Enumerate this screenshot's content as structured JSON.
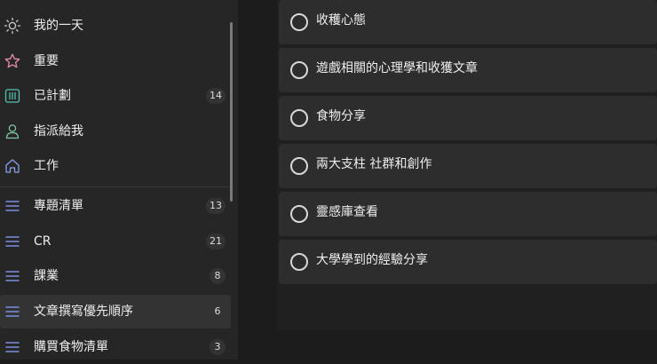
{
  "sidebar": {
    "smart_lists": [
      {
        "label": "我的一天",
        "icon": "sun-icon",
        "count": ""
      },
      {
        "label": "重要",
        "icon": "star-icon",
        "count": ""
      },
      {
        "label": "已計劃",
        "icon": "calendar-icon",
        "count": "14"
      },
      {
        "label": "指派給我",
        "icon": "person-icon",
        "count": ""
      },
      {
        "label": "工作",
        "icon": "home-icon",
        "count": ""
      }
    ],
    "lists": [
      {
        "label": "專題清單",
        "icon": "list-icon",
        "count": "13"
      },
      {
        "label": "CR",
        "icon": "list-icon",
        "count": "21"
      },
      {
        "label": "課業",
        "icon": "list-icon",
        "count": "8"
      },
      {
        "label": "文章撰寫優先順序",
        "icon": "list-icon",
        "count": "6",
        "selected": true
      },
      {
        "label": "購買食物清單",
        "icon": "list-icon",
        "count": "3"
      }
    ]
  },
  "tasks": [
    {
      "title": "收穫心態",
      "completed": false
    },
    {
      "title": "遊戲相關的心理學和收獲文章",
      "completed": false
    },
    {
      "title": "食物分享",
      "completed": false
    },
    {
      "title": "兩大支柱 社群和創作",
      "completed": false
    },
    {
      "title": "靈感庫查看",
      "completed": false
    },
    {
      "title": "大學學到的經驗分享",
      "completed": false
    }
  ],
  "colors": {
    "sidebar_bg": "#262626",
    "main_bg": "#1c1c1c",
    "task_bg": "#2d2d2d",
    "star_pink": "#e88aa8",
    "calendar_teal": "#55c2b0",
    "person_green": "#7cc4a2",
    "home_blue": "#8aa0e8",
    "list_blue": "#7b8fe0"
  }
}
